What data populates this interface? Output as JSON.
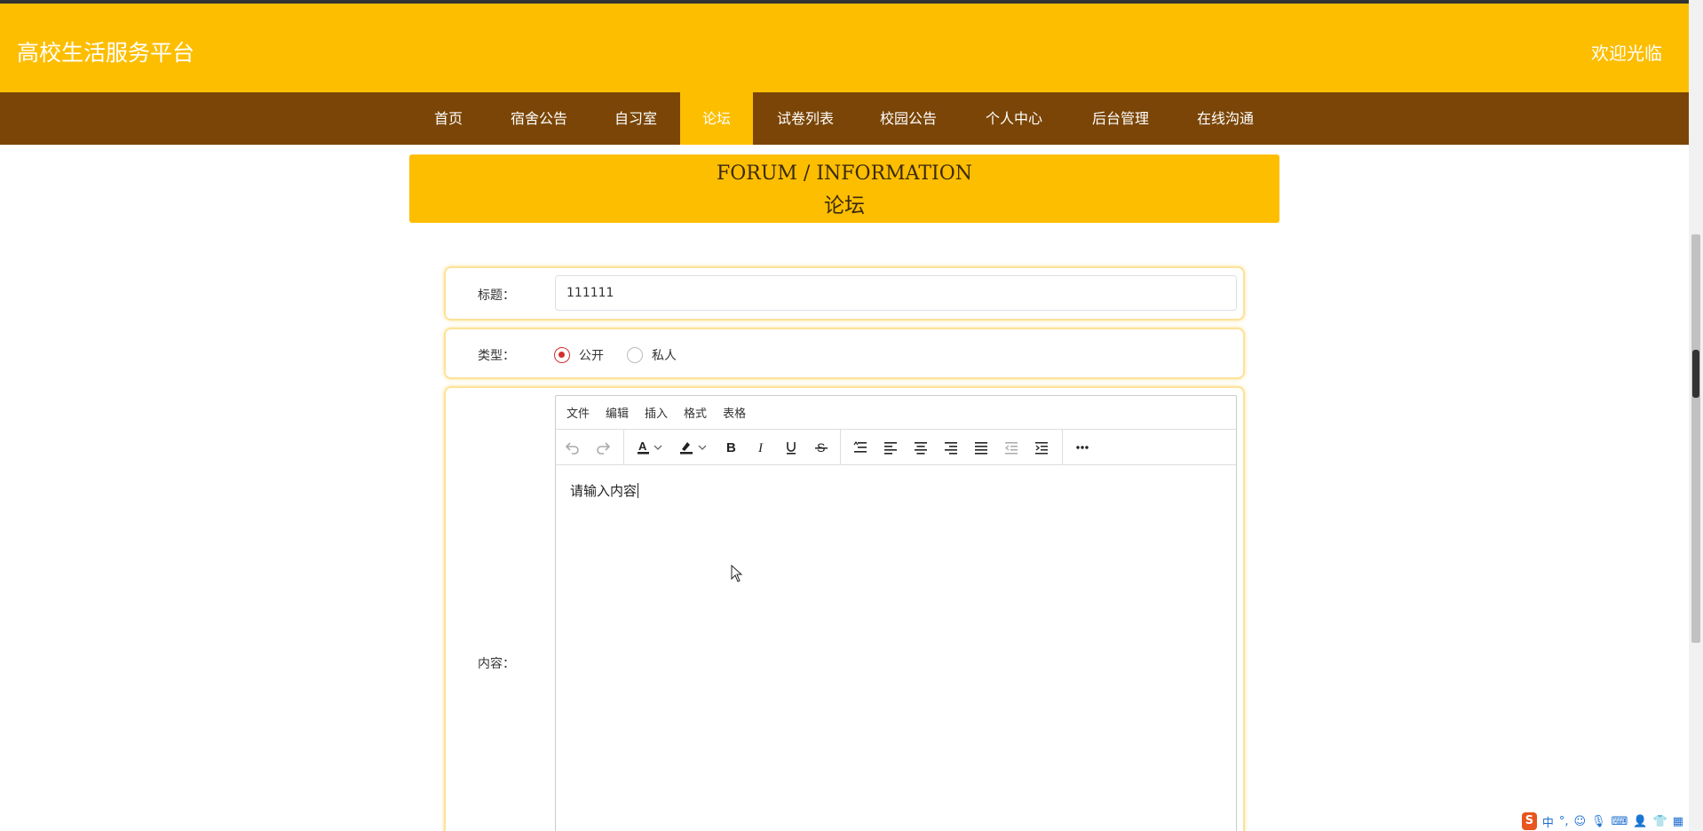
{
  "header": {
    "site_title": "高校生活服务平台",
    "welcome": "欢迎光临"
  },
  "nav": {
    "items": [
      {
        "label": "首页"
      },
      {
        "label": "宿舍公告"
      },
      {
        "label": "自习室"
      },
      {
        "label": "论坛"
      },
      {
        "label": "试卷列表"
      },
      {
        "label": "校园公告"
      },
      {
        "label": "个人中心"
      },
      {
        "label": "后台管理"
      },
      {
        "label": "在线沟通"
      }
    ],
    "active": "论坛"
  },
  "banner": {
    "en": "FORUM / INFORMATION",
    "cn": "论坛"
  },
  "form": {
    "title_label": "标题：",
    "title_value": "111111",
    "type_label": "类型：",
    "type_options": [
      "公开",
      "私人"
    ],
    "type_selected": "公开",
    "content_label": "内容：",
    "editor": {
      "menus": [
        "文件",
        "编辑",
        "插入",
        "格式",
        "表格"
      ],
      "toolbar_icons": [
        "undo-icon",
        "redo-icon",
        "text-color-icon",
        "highlight-color-icon",
        "bold-icon",
        "italic-icon",
        "underline-icon",
        "strikethrough-icon",
        "line-height-icon",
        "align-left-icon",
        "align-center-icon",
        "align-right-icon",
        "align-justify-icon",
        "outdent-icon",
        "indent-icon",
        "more-icon"
      ],
      "placeholder": "请输入内容"
    }
  },
  "ime": {
    "logo": "S",
    "mode": "中",
    "punct": "°,"
  },
  "colors": {
    "header_bg": "#FDBE00",
    "nav_bg": "#7A4506",
    "radio_accent": "#D32F2F"
  }
}
